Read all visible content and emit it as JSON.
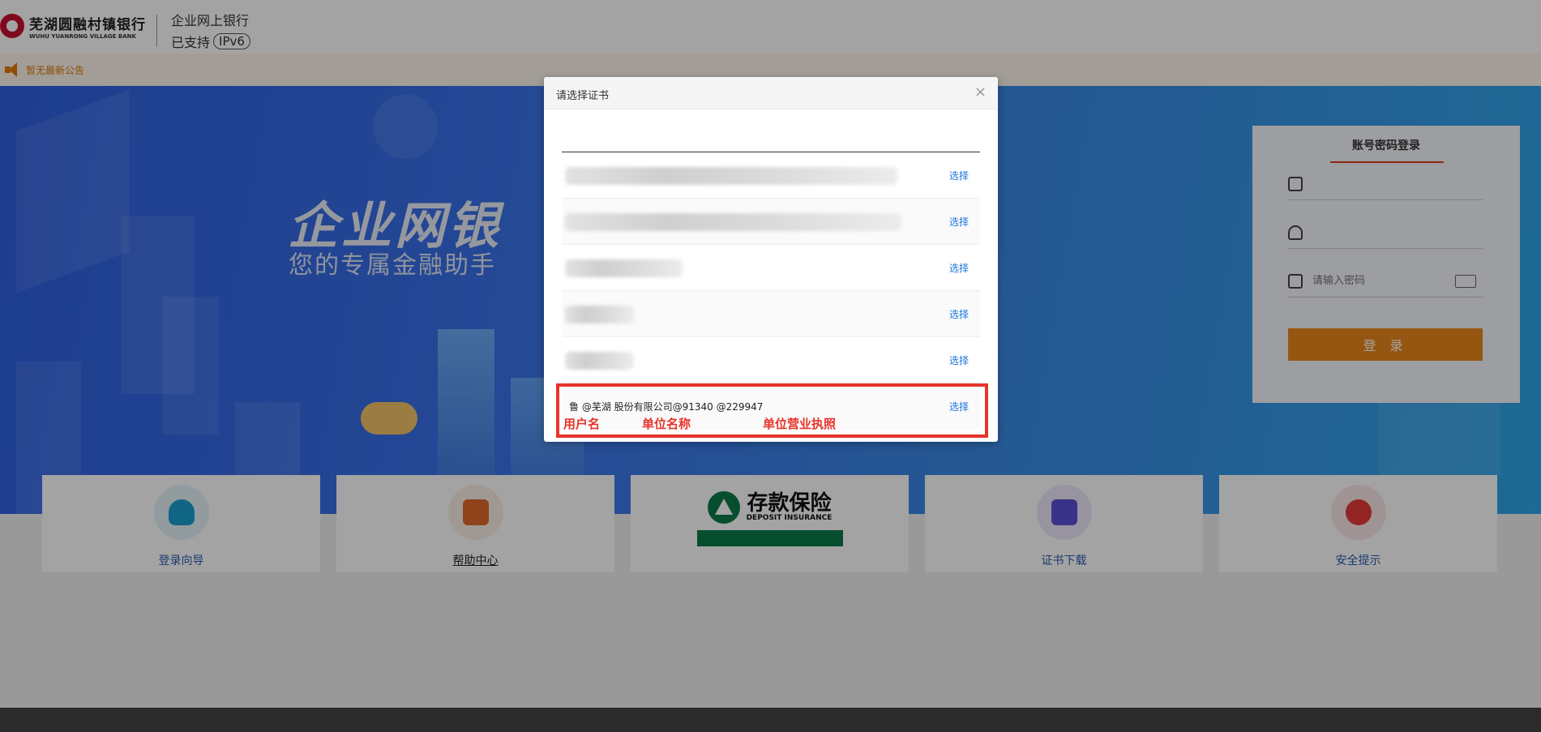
{
  "header": {
    "bank_name_cn": "芜湖圆融村镇银行",
    "bank_name_en": "WUHU YUANRONG VILLAGE BANK",
    "title": "企业网上银行",
    "support_prefix": "已支持",
    "ipv6": "IPv6"
  },
  "notice": {
    "text": "暂无最新公告"
  },
  "hero": {
    "title": "企业网银",
    "subtitle": "您的专属金融助手"
  },
  "login": {
    "tab": "账号密码登录",
    "password_placeholder": "请输入密码",
    "button": "登 录"
  },
  "cards": [
    {
      "label": "登录向导"
    },
    {
      "label": "帮助中心"
    },
    {
      "label": ""
    },
    {
      "label": "证书下载"
    },
    {
      "label": "安全提示"
    }
  ],
  "deposit": {
    "cn": "存款保险",
    "en": "DEPOSIT INSURANCE"
  },
  "dialog": {
    "title": "请选择证书",
    "close": "×",
    "rows": [
      {
        "name": "",
        "select": "选择"
      },
      {
        "name": "",
        "select": "选择"
      },
      {
        "name": "",
        "select": "选择"
      },
      {
        "name": "",
        "select": "选择"
      },
      {
        "name": "",
        "select": "选择"
      },
      {
        "name": "鲁 @芜湖 股份有限公司@91340 @229947",
        "select": "选择"
      }
    ]
  },
  "annotations": {
    "username": "用户名",
    "unit_name": "单位名称",
    "license": "单位营业执照"
  },
  "colors": {
    "accent_orange": "#e9871c",
    "link_blue": "#1a73d9",
    "highlight_red": "#e8342a"
  }
}
